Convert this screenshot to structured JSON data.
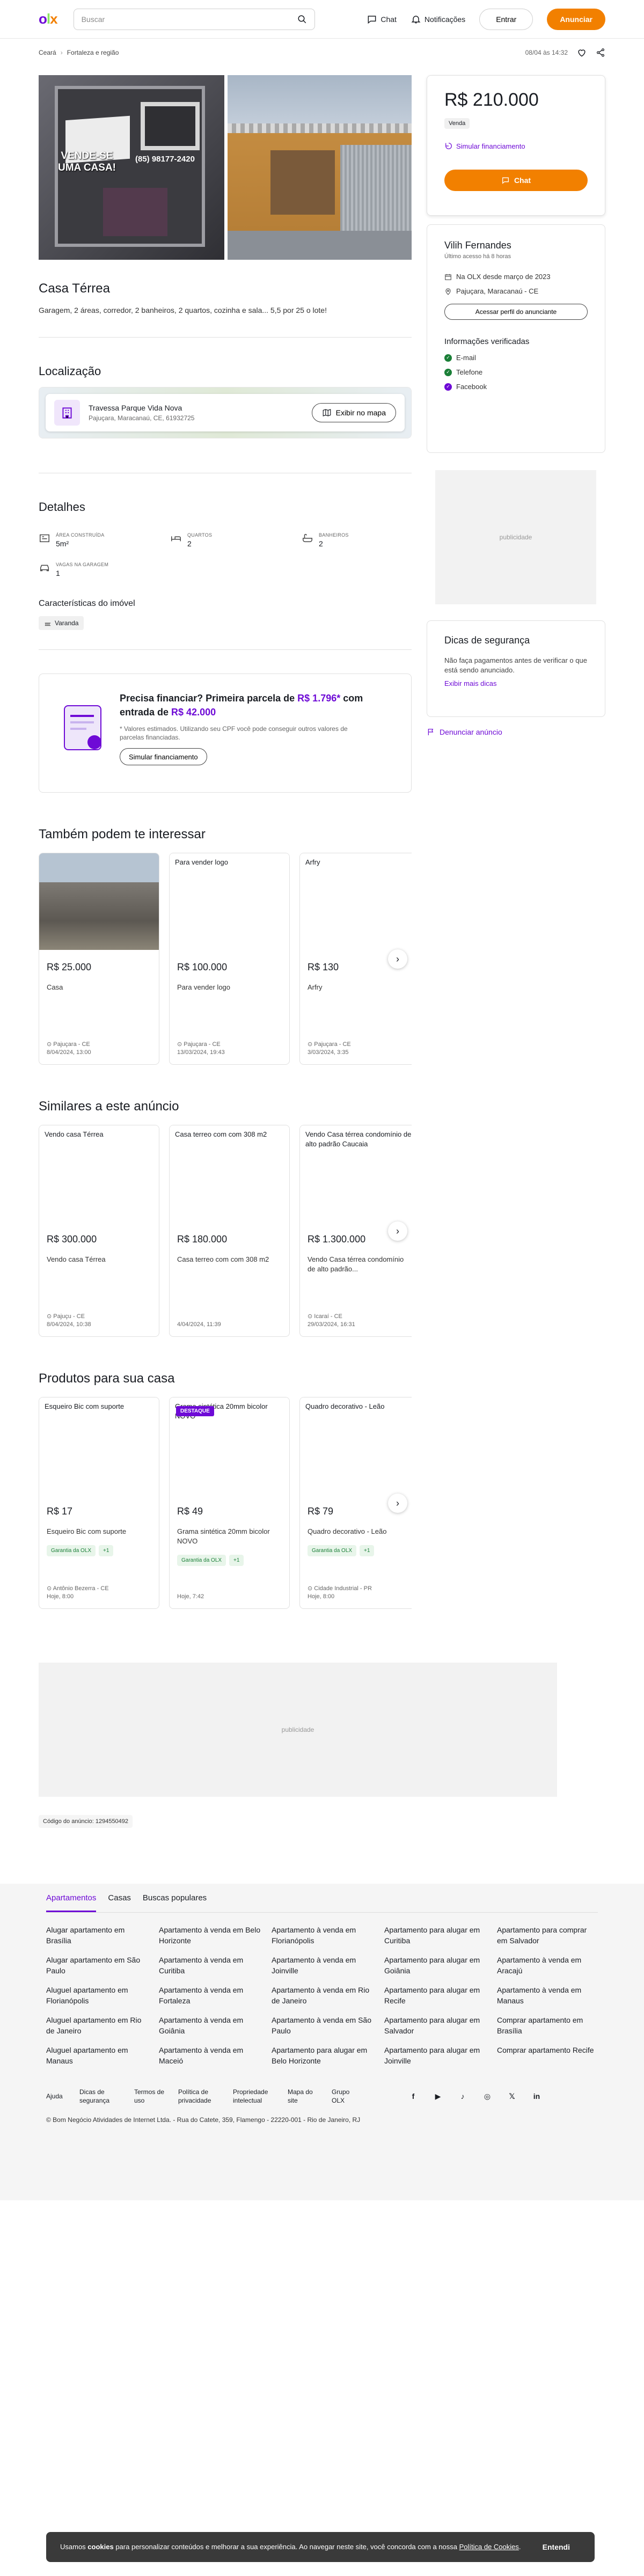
{
  "header": {
    "search_placeholder": "Buscar",
    "chat_label": "Chat",
    "notifications_label": "Notificações",
    "login_label": "Entrar",
    "post_label": "Anunciar"
  },
  "breadcrumb": {
    "items": [
      "Ceará",
      "Fortaleza e região"
    ],
    "date": "08/04 às 14:32"
  },
  "listing": {
    "title": "Casa Térrea",
    "description": "Garagem,  2 áreas, corredor, 2 banheiros, 2 quartos, cozinha e sala... 5,5 por 25 o lote!",
    "photo1_sign_title": "VENDE-SE UMA CASA!",
    "photo1_phone": "(85) 98177-2420"
  },
  "location": {
    "heading": "Localização",
    "street": "Travessa Parque Vida Nova",
    "city": "Pajuçara, Maracanaú, CE, 61932725",
    "map_button": "Exibir no mapa"
  },
  "details": {
    "heading": "Detalhes",
    "items": [
      {
        "label": "ÁREA CONSTRUÍDA",
        "value": "5m²"
      },
      {
        "label": "QUARTOS",
        "value": "2"
      },
      {
        "label": "BANHEIROS",
        "value": "2"
      },
      {
        "label": "VAGAS NA GARAGEM",
        "value": "1"
      }
    ],
    "features_heading": "Características do imóvel",
    "feature_chip": "Varanda"
  },
  "financing": {
    "title_pre": "Precisa financiar? Primeira parcela de ",
    "installment": "R$ 1.796*",
    "title_mid": " com entrada de ",
    "down": "R$ 42.000",
    "note": "* Valores estimados. Utilizando seu CPF você pode conseguir outros valores de parcelas financiadas.",
    "button": "Simular financiamento"
  },
  "section_interest": {
    "heading": "Também podem te interessar",
    "cards": [
      {
        "img_text": "",
        "price": "R$ 25.000",
        "title": "Casa",
        "place": "Pajuçara - CE",
        "date": "8/04/2024, 13:00"
      },
      {
        "img_text": "Para vender logo",
        "price": "R$ 100.000",
        "title": "Para vender logo",
        "place": "Pajuçara - CE",
        "date": "13/03/2024, 19:43"
      },
      {
        "img_text": "Arfry",
        "price": "R$ 130",
        "title": "Arfry",
        "place": "Pajuçara - CE",
        "date": "3/03/2024, 3:35"
      }
    ]
  },
  "section_similar": {
    "heading": "Similares a este anúncio",
    "cards": [
      {
        "img_text": "Vendo casa Térrea",
        "price": "R$ 300.000",
        "title": "Vendo casa Térrea",
        "place": "Pajuçu - CE",
        "date": "8/04/2024, 10:38"
      },
      {
        "img_text": "Casa terreo com com 308 m2",
        "price": "R$ 180.000",
        "title": "Casa terreo com com 308 m2",
        "place": "",
        "date": "4/04/2024, 11:39"
      },
      {
        "img_text": "Vendo Casa térrea condomínio de alto padrão Caucaia",
        "price": "R$ 1.300.000",
        "title": "Vendo Casa térrea condomínio de alto padrão...",
        "place": "Icaraí - CE",
        "date": "29/03/2024, 16:31"
      }
    ]
  },
  "section_products": {
    "heading": "Produtos para sua casa",
    "destaque": "DESTAQUE",
    "guarantee": "Garantia da OLX",
    "plus": "+1",
    "cards": [
      {
        "img_text": "Esqueiro Bic com suporte",
        "price": "R$ 17",
        "title": "Esqueiro Bic com suporte",
        "place": "Antônio Bezerra - CE",
        "date": "Hoje, 8:00"
      },
      {
        "img_text": "Grama sintética 20mm bicolor NOVO",
        "price": "R$ 49",
        "title": "Grama sintética 20mm bicolor NOVO",
        "place": "",
        "date": "Hoje, 7:42"
      },
      {
        "img_text": "Quadro decorativo - Leão",
        "price": "R$ 79",
        "title": "Quadro decorativo - Leão",
        "place": "Cidade Industrial - PR",
        "date": "Hoje, 8:00"
      }
    ]
  },
  "ad_label": "publicidade",
  "ad_code": "Código do anúncio: 1294550492",
  "sidebar": {
    "price": "R$ 210.000",
    "type": "Venda",
    "simulate": "Simular financiamento",
    "chat": "Chat",
    "seller_name": "Vilih Fernandes",
    "last_access": "Último acesso há 8 horas",
    "since": "Na OLX desde março de 2023",
    "seller_location": "Pajuçara, Maracanaú - CE",
    "profile_button": "Acessar perfil do anunciante",
    "verified_heading": "Informações verificadas",
    "verified": [
      "E-mail",
      "Telefone",
      "Facebook"
    ],
    "tips_title": "Dicas de segurança",
    "tips_text": "Não faça pagamentos antes de verificar o que está sendo anunciado.",
    "tips_link": "Exibir mais dicas",
    "report": "Denunciar anúncio"
  },
  "footer": {
    "tabs": [
      "Apartamentos",
      "Casas",
      "Buscas populares"
    ],
    "links": [
      "Alugar apartamento em Brasília",
      "Apartamento à venda em Belo Horizonte",
      "Apartamento à venda em Florianópolis",
      "Apartamento para alugar em Curitiba",
      "Apartamento para comprar em Salvador",
      "Alugar apartamento em São Paulo",
      "Apartamento à venda em Curitiba",
      "Apartamento à venda em Joinville",
      "Apartamento para alugar em Goiânia",
      "Apartamento à venda em Aracajú",
      "Aluguel apartamento em Florianópolis",
      "Apartamento à venda em Fortaleza",
      "Apartamento à venda em Rio de Janeiro",
      "Apartamento para alugar em Recife",
      "Apartamento à venda em Manaus",
      "Aluguel apartamento em Rio de Janeiro",
      "Apartamento à venda em Goiânia",
      "Apartamento à venda em São Paulo",
      "Apartamento para alugar em Salvador",
      "Comprar apartamento em Brasília",
      "Aluguel apartamento em Manaus",
      "Apartamento à venda em Maceió",
      "Apartamento para alugar em Belo Horizonte",
      "Apartamento para alugar em Joinville",
      "Comprar apartamento Recife"
    ],
    "bottom_links": [
      "Ajuda",
      "Dicas de segurança",
      "Termos de uso",
      "Política de privacidade",
      "Propriedade intelectual",
      "Mapa do site",
      "Grupo OLX"
    ],
    "copyright": "© Bom Negócio Atividades de Internet Ltda. - Rua do Catete, 359, Flamengo - 22220-001 - Rio de Janeiro, RJ"
  },
  "cookie": {
    "pre": "Usamos ",
    "bold": "cookies",
    "mid": " para personalizar conteúdos e melhorar a sua experiência. Ao navegar neste site, você concorda com a nossa ",
    "link": "Política de Cookies",
    "post": ".",
    "button": "Entendi"
  },
  "colors": {
    "brand_purple": "#6e0ad6",
    "brand_orange": "#f28000",
    "brand_green": "#8ce563"
  }
}
